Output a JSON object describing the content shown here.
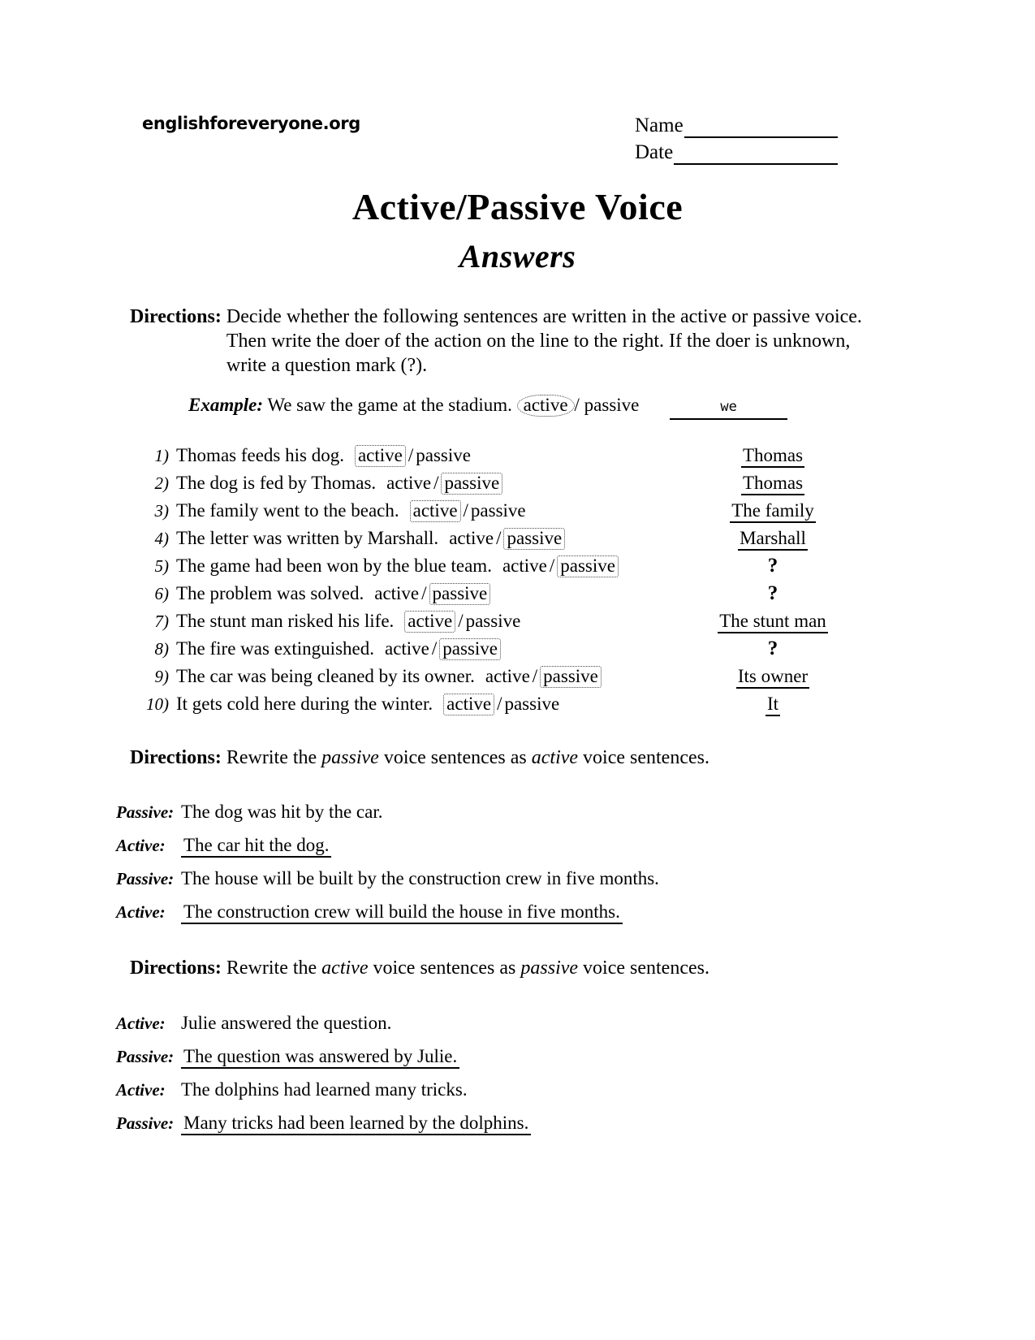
{
  "header": {
    "site_url": "englishforeveryone.org",
    "name_label": "Name",
    "date_label": "Date"
  },
  "title": {
    "main": "Active/Passive Voice",
    "sub": "Answers"
  },
  "directions": {
    "one": {
      "label": "Directions:",
      "text": "Decide whether the following sentences are written in the active or passive voice. Then write the doer of the action on the line to the right. If the doer is unknown, write a question mark (?)."
    },
    "two": {
      "label": "Directions:",
      "prefix": "Rewrite the ",
      "em1": "passive",
      "mid": " voice sentences as ",
      "em2": "active",
      "suffix": " voice sentences."
    },
    "three": {
      "label": "Directions:",
      "prefix": "Rewrite the ",
      "em1": "active",
      "mid": " voice sentences as ",
      "em2": "passive",
      "suffix": " voice sentences."
    }
  },
  "example": {
    "label": "Example:",
    "sentence": "We saw the game at the stadium.",
    "choice_active": "active",
    "separator": "/",
    "choice_passive": "passive",
    "answer": "we",
    "circled": "active"
  },
  "questions": [
    {
      "num": "1)",
      "sentence": "Thomas feeds his dog.",
      "active": "active",
      "separator": "/",
      "passive": "passive",
      "selected": "active",
      "answer": "Thomas",
      "answer_underlined": true
    },
    {
      "num": "2)",
      "sentence": "The dog is fed by Thomas.",
      "active": "active",
      "separator": "/",
      "passive": "passive",
      "selected": "passive",
      "answer": "Thomas",
      "answer_underlined": true
    },
    {
      "num": "3)",
      "sentence": "The family went to the beach.",
      "active": "active",
      "separator": "/",
      "passive": "passive",
      "selected": "active",
      "answer": "The family",
      "answer_underlined": true
    },
    {
      "num": "4)",
      "sentence": "The letter was written by Marshall.",
      "active": "active",
      "separator": "/",
      "passive": "passive",
      "selected": "passive",
      "answer": "Marshall",
      "answer_underlined": true
    },
    {
      "num": "5)",
      "sentence": "The game had been won by the blue team.",
      "active": "active",
      "separator": "/",
      "passive": "passive",
      "selected": "passive",
      "answer": "?",
      "answer_underlined": false
    },
    {
      "num": "6)",
      "sentence": "The problem was solved.",
      "active": "active",
      "separator": "/",
      "passive": "passive",
      "selected": "passive",
      "answer": "?",
      "answer_underlined": false
    },
    {
      "num": "7)",
      "sentence": "The stunt man risked his life.",
      "active": "active",
      "separator": "/",
      "passive": "passive",
      "selected": "active",
      "answer": "The stunt man",
      "answer_underlined": true
    },
    {
      "num": "8)",
      "sentence": "The fire was extinguished.",
      "active": "active",
      "separator": "/",
      "passive": "passive",
      "selected": "passive",
      "answer": "?",
      "answer_underlined": false
    },
    {
      "num": "9)",
      "sentence": "The car was being cleaned by its owner.",
      "active": "active",
      "separator": "/",
      "passive": "passive",
      "selected": "passive",
      "answer": "Its owner",
      "answer_underlined": true
    },
    {
      "num": "10)",
      "sentence": "It gets cold here during the winter.",
      "active": "active",
      "separator": "/",
      "passive": "passive",
      "selected": "active",
      "answer": "It",
      "answer_underlined": true
    }
  ],
  "rewrite_passive_to_active": [
    {
      "label": "Passive:",
      "text": "The dog was hit by the car.",
      "is_answer": false
    },
    {
      "label": "Active:",
      "text": "The car hit the dog.",
      "is_answer": true
    },
    {
      "label": "Passive:",
      "text": "The house will be built by the construction crew in five months.",
      "is_answer": false
    },
    {
      "label": "Active:",
      "text": "The construction crew will build the house in five months.",
      "is_answer": true
    }
  ],
  "rewrite_active_to_passive": [
    {
      "label": "Active:",
      "text": "Julie answered the question.",
      "is_answer": false
    },
    {
      "label": "Passive:",
      "text": "The question was answered by Julie.",
      "is_answer": true
    },
    {
      "label": "Active:",
      "text": "The dolphins had learned many tricks.",
      "is_answer": false
    },
    {
      "label": "Passive:",
      "text": "Many tricks had been learned by the dolphins.",
      "is_answer": true
    }
  ],
  "colors": {
    "ink": "#000000",
    "paper": "#ffffff",
    "marking": "#3a3a3a"
  }
}
